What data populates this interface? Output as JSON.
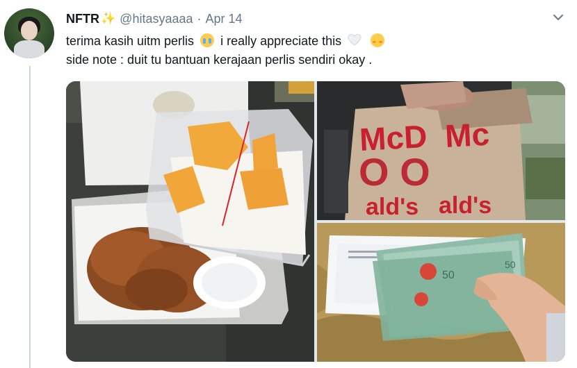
{
  "tweet": {
    "author_name": "NFTR",
    "author_emoji": "✨",
    "handle": "@hitasyaaaa",
    "separator": "·",
    "date": "Apr 14",
    "text_line1_a": "terima kasih uitm perlis",
    "text_line1_b": "i really appreciate this",
    "text_line2": "side note : duit tu bantuan kerajaan perlis sendiri okay .",
    "emojis": [
      "crying-face-emoji",
      "white-heart-emoji",
      "smiling-face-with-hearts-emoji"
    ]
  },
  "icons": {
    "more": "chevron-down-icon"
  },
  "media": {
    "photos": [
      {
        "subject": "food-box-photo"
      },
      {
        "subject": "mcdonalds-bag-photo"
      },
      {
        "subject": "cash-envelope-photo"
      }
    ],
    "photo_text": [
      "McD",
      "Mc",
      "ald's",
      "ald's",
      "50",
      "50"
    ]
  },
  "colors": {
    "text": "#14171a",
    "secondary": "#657786",
    "sparkle": "#f4b400",
    "mcd_red": "#c8202f"
  }
}
